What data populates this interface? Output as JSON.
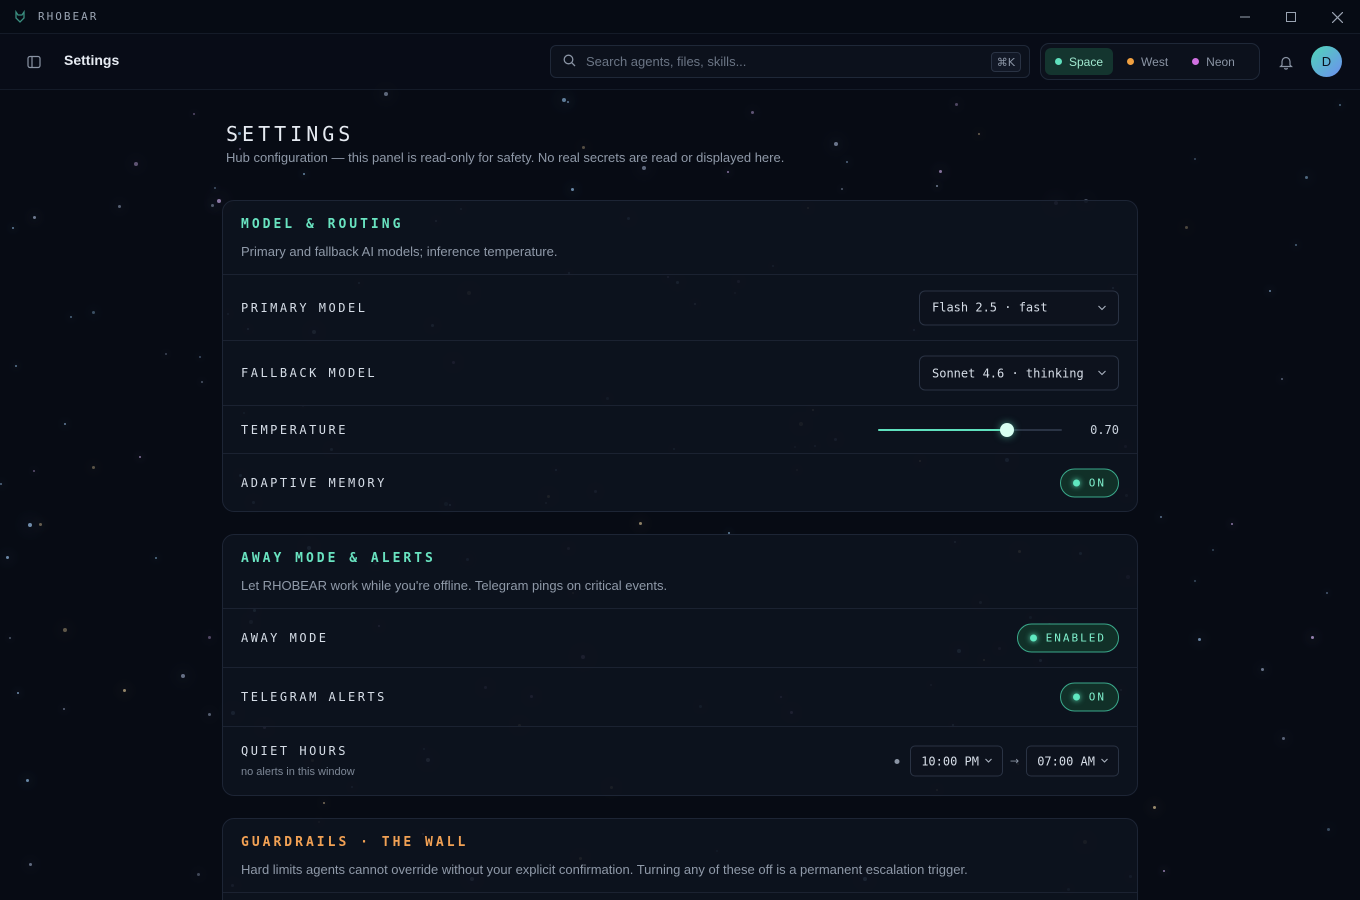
{
  "app": {
    "name": "RHOBEAR"
  },
  "window_controls": {
    "minimize": "minimize-icon",
    "maximize": "maximize-icon",
    "close": "close-icon"
  },
  "header": {
    "title": "Settings",
    "search": {
      "placeholder": "Search agents, files, skills...",
      "value": "",
      "shortcut": "⌘K"
    },
    "themes": [
      {
        "label": "Space",
        "color": "#5fe0bd",
        "active": true
      },
      {
        "label": "West",
        "color": "#f0a040",
        "active": false
      },
      {
        "label": "Neon",
        "color": "#d070e0",
        "active": false
      }
    ],
    "avatar_initial": "D"
  },
  "page": {
    "heading": "SETTINGS",
    "subtitle": "Hub configuration — this panel is read-only for safety. No real secrets are read or displayed here."
  },
  "sections": {
    "model": {
      "title": "MODEL & ROUTING",
      "description": "Primary and fallback AI models; inference temperature.",
      "primary_label": "PRIMARY MODEL",
      "primary_value": "Flash 2.5 · fast",
      "fallback_label": "FALLBACK MODEL",
      "fallback_value": "Sonnet 4.6 · thinking",
      "temperature_label": "TEMPERATURE",
      "temperature_value": "0.70",
      "temperature_fraction": 0.7,
      "memory_label": "ADAPTIVE MEMORY",
      "memory_state": "ON"
    },
    "away": {
      "title": "AWAY MODE & ALERTS",
      "description": "Let RHOBEAR work while you're offline. Telegram pings on critical events.",
      "away_label": "AWAY MODE",
      "away_state": "ENABLED",
      "telegram_label": "TELEGRAM ALERTS",
      "telegram_state": "ON",
      "quiet_label": "QUIET HOURS",
      "quiet_sub": "no alerts in this window",
      "quiet_start": "10:00 PM",
      "quiet_arrow": "→",
      "quiet_end": "07:00 AM"
    },
    "guardrails": {
      "title": "GUARDRAILS · THE WALL",
      "description": "Hard limits agents cannot override without your explicit confirmation. Turning any of these off is a permanent escalation trigger."
    }
  }
}
